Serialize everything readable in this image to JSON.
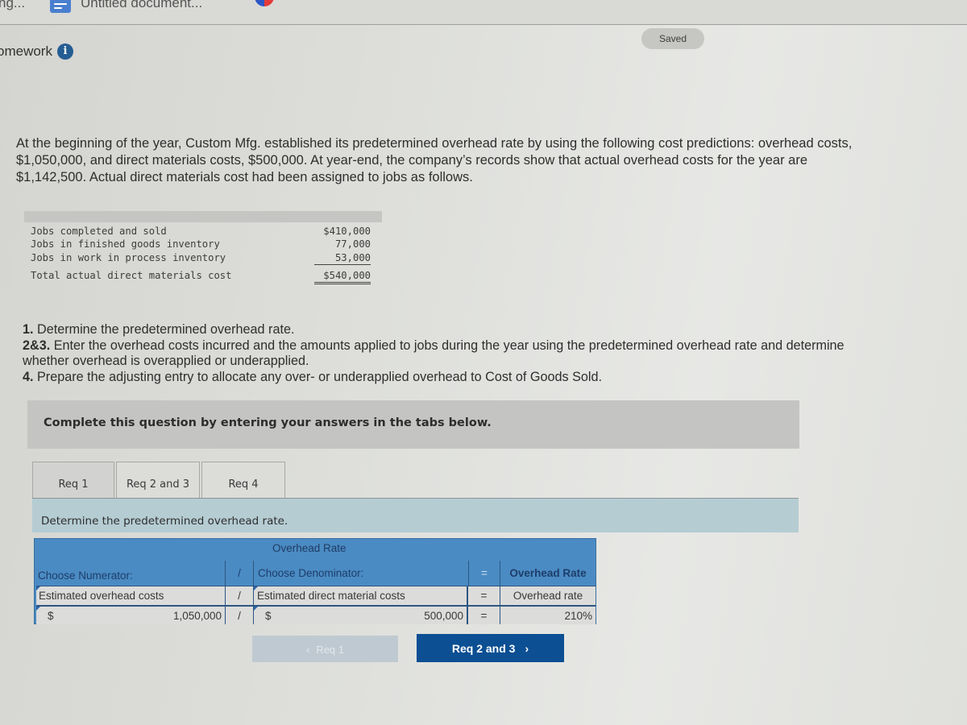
{
  "browser": {
    "tabs": [
      {
        "label": "ng..."
      },
      {
        "label": "Untitled document..."
      }
    ]
  },
  "header": {
    "title": "omework",
    "info_icon": "info-icon",
    "saved_label": "Saved"
  },
  "problem": {
    "intro": "At the beginning of the year, Custom Mfg. established its predetermined overhead rate by using the following cost predictions: overhead costs, $1,050,000, and direct materials costs, $500,000. At year-end, the company’s records show that actual overhead costs for the year are $1,142,500. Actual direct materials cost had been assigned to jobs as follows.",
    "materials_table": [
      {
        "label": "Jobs completed and sold",
        "amount": "$410,000"
      },
      {
        "label": "Jobs in finished goods inventory",
        "amount": "77,000"
      },
      {
        "label": "Jobs in work in process inventory",
        "amount": "53,000"
      },
      {
        "label": "Total actual direct materials cost",
        "amount": "$540,000"
      }
    ],
    "requirements": [
      {
        "num": "1.",
        "text": " Determine the predetermined overhead rate."
      },
      {
        "num": "2&3.",
        "text": " Enter the overhead costs incurred and the amounts applied to jobs during the year using the predetermined overhead rate and determine whether overhead is overapplied or underapplied."
      },
      {
        "num": "4.",
        "text": " Prepare the adjusting entry to allocate any over- or underapplied overhead to Cost of Goods Sold."
      }
    ]
  },
  "instructions": {
    "complete_text": "Complete this question by entering your answers in the tabs below."
  },
  "req_tabs": [
    {
      "label": "Req 1",
      "active": true
    },
    {
      "label": "Req 2 and 3",
      "active": false
    },
    {
      "label": "Req 4",
      "active": false
    }
  ],
  "req1": {
    "instruction": "Determine the predetermined overhead rate.",
    "table": {
      "title": "Overhead Rate",
      "numerator_header": "Choose Numerator:",
      "slash": "/",
      "denominator_header": "Choose Denominator:",
      "equals": "=",
      "result_header": "Overhead Rate",
      "numerator_label": "Estimated overhead costs",
      "denominator_label": "Estimated direct material costs",
      "result_label": "Overhead rate",
      "currency": "$",
      "numerator_value": "1,050,000",
      "denominator_value": "500,000",
      "result_value": "210%"
    }
  },
  "navigation": {
    "prev_label": "Req 1",
    "next_label": "Req 2 and 3",
    "prev_chevron": "‹",
    "next_chevron": "›"
  }
}
